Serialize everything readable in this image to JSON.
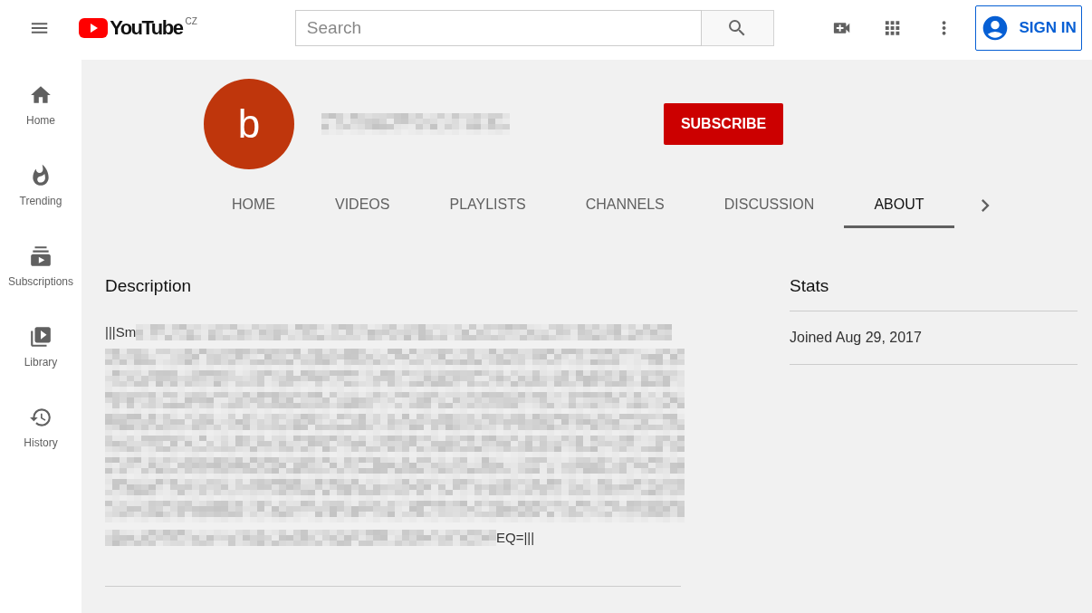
{
  "header": {
    "logo_text": "YouTube",
    "country": "CZ",
    "search": {
      "placeholder": "Search"
    },
    "sign_in": "SIGN IN"
  },
  "sidebar": {
    "items": [
      {
        "label": "Home",
        "selected": false
      },
      {
        "label": "Trending",
        "selected": false
      },
      {
        "label": "Subscriptions",
        "selected": false
      },
      {
        "label": "Library",
        "selected": false
      },
      {
        "label": "History",
        "selected": false
      }
    ]
  },
  "channel": {
    "avatar_letter": "b",
    "subscribe": "SUBSCRIBE"
  },
  "tabs": [
    {
      "label": "HOME",
      "selected": false
    },
    {
      "label": "VIDEOS",
      "selected": false
    },
    {
      "label": "PLAYLISTS",
      "selected": false
    },
    {
      "label": "CHANNELS",
      "selected": false
    },
    {
      "label": "DISCUSSION",
      "selected": false
    },
    {
      "label": "ABOUT",
      "selected": true
    }
  ],
  "about": {
    "description_heading": "Description",
    "description_start": "|||Sm",
    "description_end": "EQ=|||",
    "stats_heading": "Stats",
    "joined": "Joined Aug 29, 2017"
  }
}
